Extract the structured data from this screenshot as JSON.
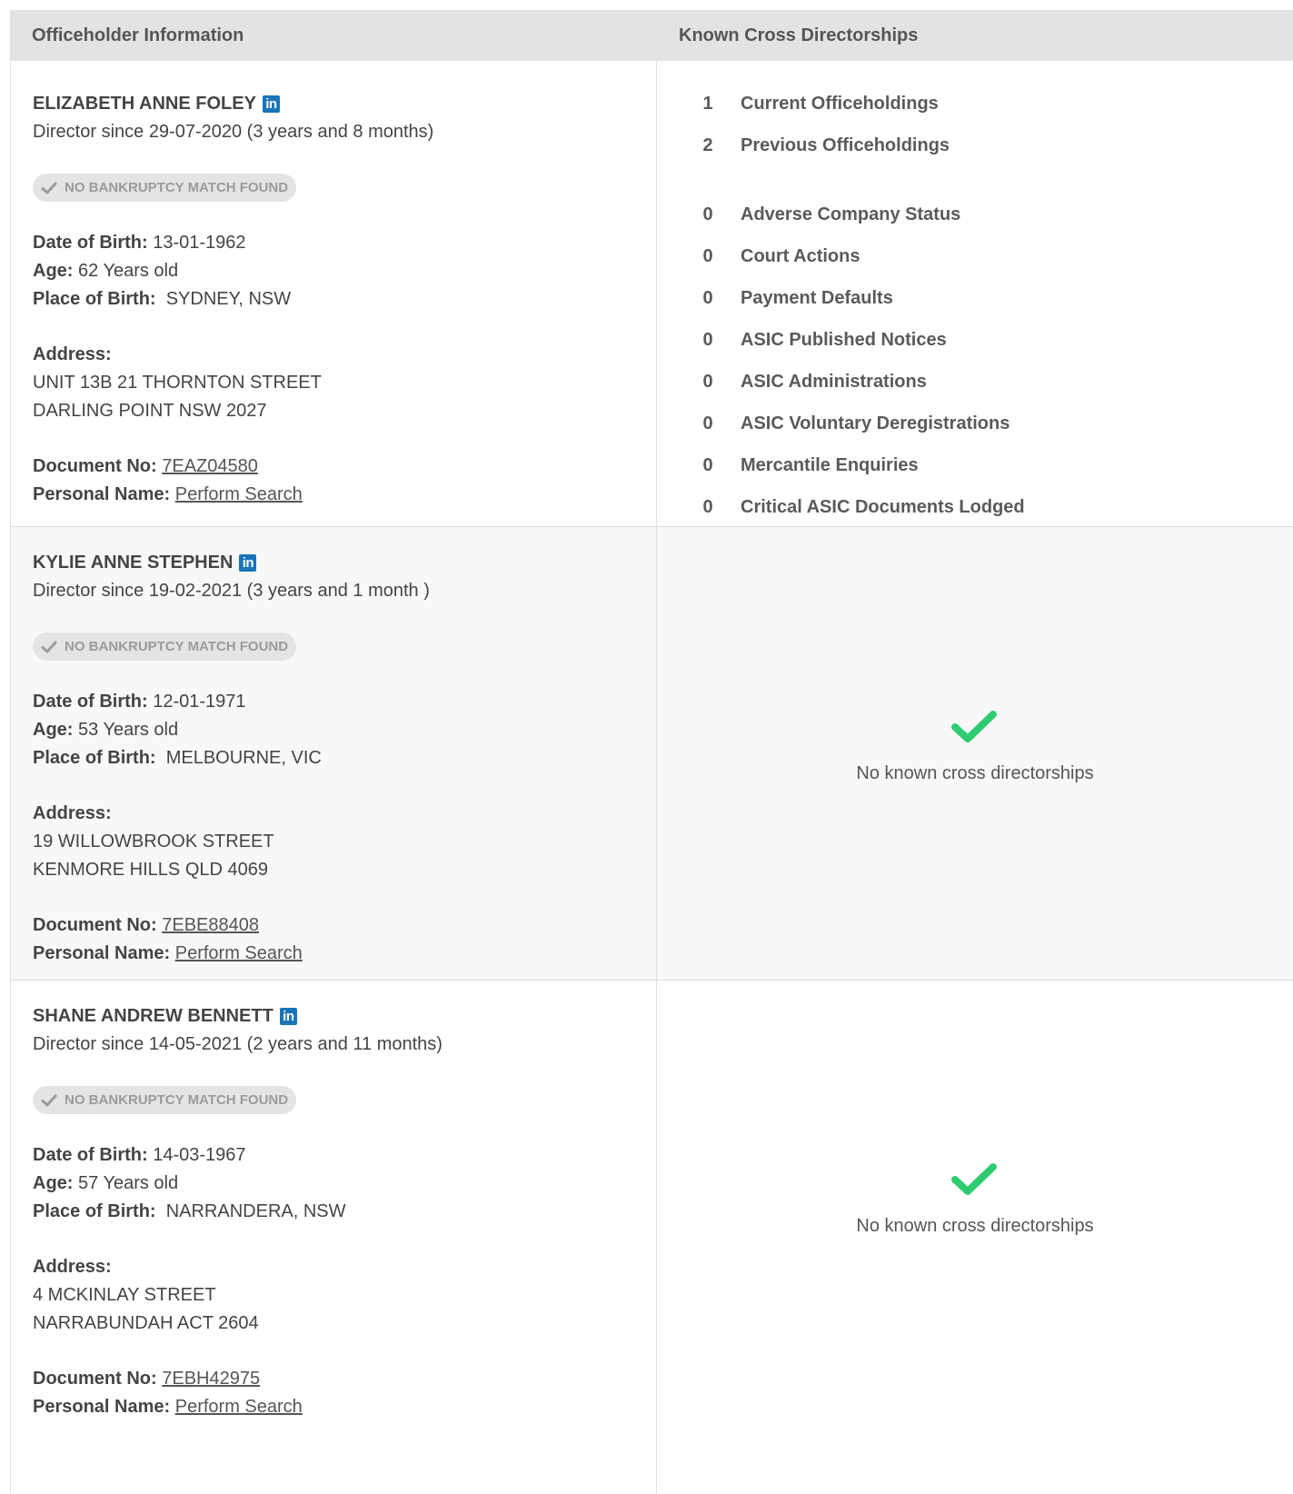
{
  "headers": {
    "col1": "Officeholder Information",
    "col2": "Known Cross Directorships"
  },
  "labels": {
    "dob": "Date of Birth:",
    "age": "Age:",
    "pob": "Place of Birth:",
    "address": "Address:",
    "doc_no": "Document No:",
    "personal_name": "Personal Name:"
  },
  "linkedin_icon_text": "in",
  "officers": [
    {
      "name": "ELIZABETH ANNE FOLEY",
      "since": "Director since 29-07-2020 (3 years and 8 months)",
      "badge": "NO BANKRUPTCY MATCH FOUND",
      "dob": "13-01-1962",
      "age": "62 Years old",
      "pob": "SYDNEY, NSW",
      "address1": "UNIT 13B 21 THORNTON STREET",
      "address2": "DARLING POINT NSW 2027",
      "doc_no": "7EAZ04580",
      "personal_name": "Perform Search"
    },
    {
      "name": "KYLIE ANNE STEPHEN",
      "since": "Director since 19-02-2021 (3 years and 1 month )",
      "badge": "NO BANKRUPTCY MATCH FOUND",
      "dob": "12-01-1971",
      "age": "53 Years old",
      "pob": "MELBOURNE, VIC",
      "address1": "19 WILLOWBROOK STREET",
      "address2": "KENMORE HILLS QLD 4069",
      "doc_no": "7EBE88408",
      "personal_name": "Perform Search"
    },
    {
      "name": "SHANE ANDREW BENNETT",
      "since": "Director since 14-05-2021 (2 years and 11 months)",
      "badge": "NO BANKRUPTCY MATCH FOUND",
      "dob": "14-03-1967",
      "age": "57 Years old",
      "pob": "NARRANDERA, NSW",
      "address1": "4 MCKINLAY STREET",
      "address2": "NARRABUNDAH ACT 2604",
      "doc_no": "7EBH42975",
      "personal_name": "Perform Search"
    }
  ],
  "cross": {
    "stats_primary": [
      {
        "n": "1",
        "label": "Current Officeholdings"
      },
      {
        "n": "2",
        "label": "Previous Officeholdings"
      }
    ],
    "stats_secondary": [
      {
        "n": "0",
        "label": "Adverse Company Status"
      },
      {
        "n": "0",
        "label": "Court Actions"
      },
      {
        "n": "0",
        "label": "Payment Defaults"
      },
      {
        "n": "0",
        "label": "ASIC Published Notices"
      },
      {
        "n": "0",
        "label": "ASIC Administrations"
      },
      {
        "n": "0",
        "label": "ASIC Voluntary Deregistrations"
      },
      {
        "n": "0",
        "label": "Mercantile Enquiries"
      },
      {
        "n": "0",
        "label": "Critical ASIC Documents Lodged"
      }
    ],
    "none_text": "No known cross directorships"
  },
  "colors": {
    "check_green": "#2ecc71",
    "linkedin": "#1a74b8",
    "header_bg": "#e3e3e3"
  }
}
